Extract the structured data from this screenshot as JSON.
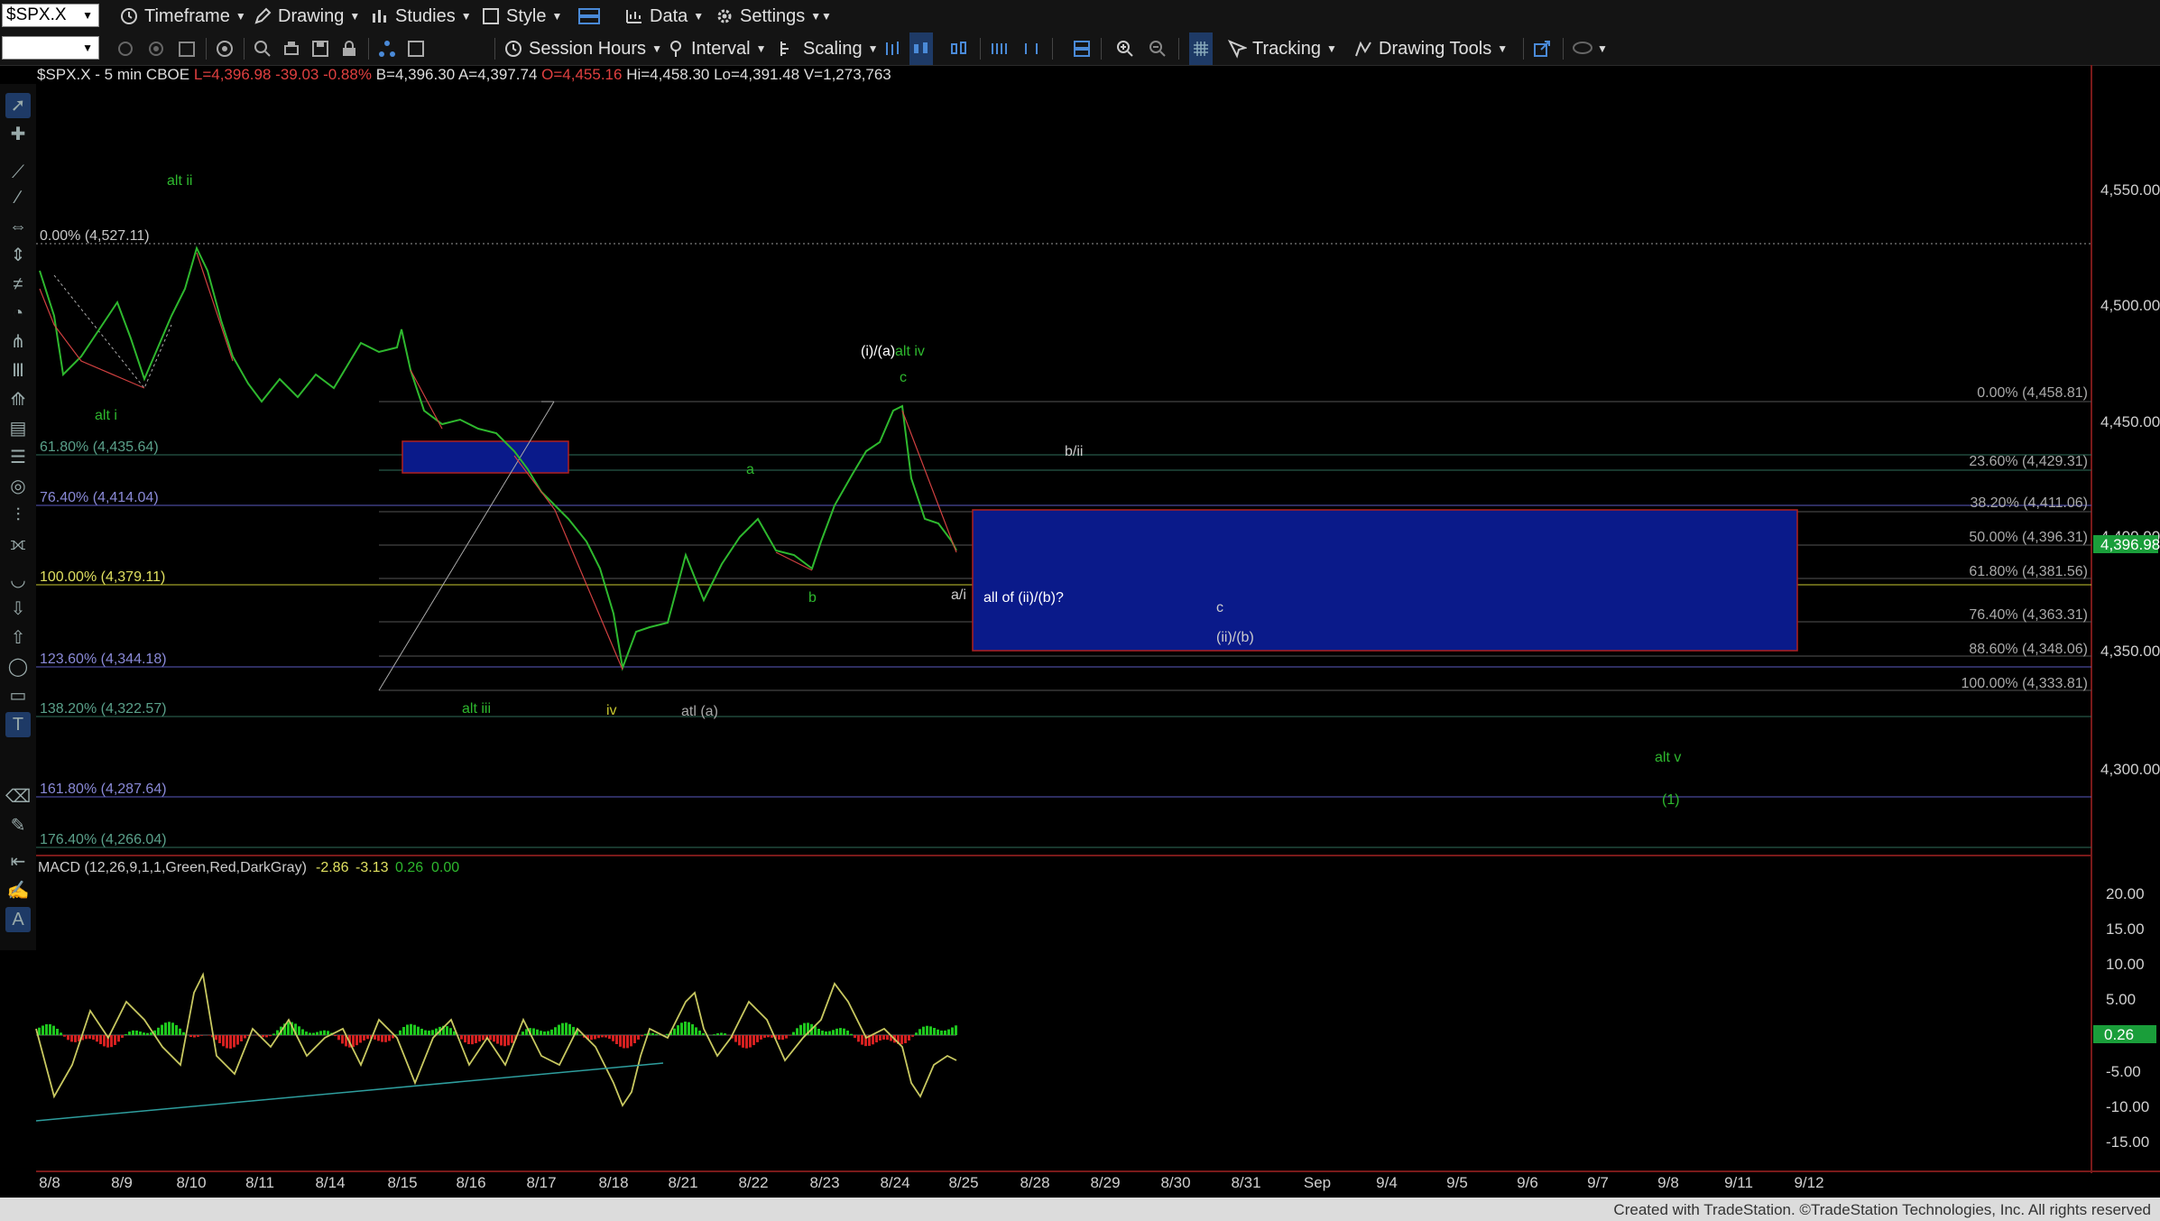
{
  "toolbar1": {
    "symbol": "$SPX.X",
    "timeframe": "Timeframe",
    "drawing": "Drawing",
    "studies": "Studies",
    "style": "Style",
    "data": "Data",
    "settings": "Settings"
  },
  "toolbar2": {
    "session_hours": "Session Hours",
    "interval": "Interval",
    "scaling": "Scaling",
    "tracking": "Tracking",
    "drawing_tools": "Drawing Tools"
  },
  "header": {
    "symbol": "$SPX.X - 5 min  CBOE",
    "last": "L=4,396.98",
    "change": "-39.03",
    "pct": "-0.88%",
    "bid": "B=4,396.30",
    "ask": "A=4,397.74",
    "open": "O=4,455.16",
    "hi": "Hi=4,458.30",
    "lo": "Lo=4,391.48",
    "vol": "V=1,273,763"
  },
  "price_axis": {
    "labels": [
      "4,550.00",
      "4,500.00",
      "4,450.00",
      "4,400.00",
      "4,350.00",
      "4,300.00"
    ],
    "last_price": "4,396.98",
    "last_price_bg": "#1a9e3a"
  },
  "macd": {
    "title": "MACD (12,26,9,1,1,Green,Red,DarkGray)",
    "v1": "-2.86",
    "v2": "-3.13",
    "v3": "0.26",
    "v4": "0.00",
    "axis": [
      "20.00",
      "15.00",
      "10.00",
      "5.00",
      "-5.00",
      "-10.00",
      "-15.00"
    ],
    "last": "0.26"
  },
  "date_axis": [
    "8/8",
    "8/9",
    "8/10",
    "8/11",
    "8/14",
    "8/15",
    "8/16",
    "8/17",
    "8/18",
    "8/21",
    "8/22",
    "8/23",
    "8/24",
    "8/25",
    "8/28",
    "8/29",
    "8/30",
    "8/31",
    "Sep",
    "9/4",
    "9/5",
    "9/6",
    "9/7",
    "9/8",
    "9/11",
    "9/12"
  ],
  "fib_left": [
    {
      "text": "0.00% (4,527.11)",
      "color": "#c8c8c8"
    },
    {
      "text": "61.80% (4,435.64)",
      "color": "#5aa08a"
    },
    {
      "text": "76.40% (4,414.04)",
      "color": "#8a8ad8"
    },
    {
      "text": "100.00% (4,379.11)",
      "color": "#e0e060"
    },
    {
      "text": "123.60% (4,344.18)",
      "color": "#8a8ad8"
    },
    {
      "text": "138.20% (4,322.57)",
      "color": "#5aa08a"
    },
    {
      "text": "161.80% (4,287.64)",
      "color": "#8a8ad8"
    },
    {
      "text": "176.40% (4,266.04)",
      "color": "#5aa08a"
    }
  ],
  "fib_right": [
    "0.00% (4,458.81)",
    "23.60% (4,429.31)",
    "38.20% (4,411.06)",
    "50.00% (4,396.31)",
    "61.80% (4,381.56)",
    "76.40% (4,363.31)",
    "88.60% (4,348.06)",
    "100.00% (4,333.81)"
  ],
  "wave_labels": {
    "alt_ii": "alt ii",
    "alt_i": "alt i",
    "alt_iii": "alt iii",
    "iv": "iv",
    "alt_a": "atl (a)",
    "i_a": "(i)/(a)",
    "alt_iv": "alt iv",
    "c_top": "c",
    "a": "a",
    "b": "b",
    "a_i": "a/i",
    "b_ii": "b/ii",
    "all_ii": "all of (ii)/(b)?",
    "c_box": "c",
    "ii_b": "(ii)/(b)",
    "alt_v": "alt v",
    "one": "(1)"
  },
  "footer": "Created with TradeStation. ©TradeStation Technologies, Inc. All rights reserved"
}
